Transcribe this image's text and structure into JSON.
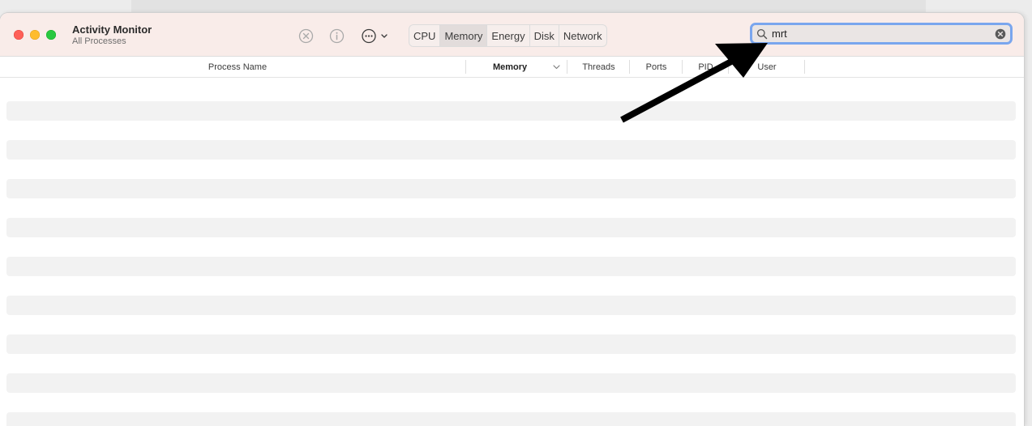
{
  "window": {
    "title": "Activity Monitor",
    "subtitle": "All Processes"
  },
  "toolbar": {
    "stop_icon": "x-circle-icon",
    "info_icon": "info-icon",
    "more_icon": "ellipsis-circle-icon",
    "tabs": [
      {
        "label": "CPU",
        "active": false
      },
      {
        "label": "Memory",
        "active": true
      },
      {
        "label": "Energy",
        "active": false
      },
      {
        "label": "Disk",
        "active": false
      },
      {
        "label": "Network",
        "active": false
      }
    ]
  },
  "search": {
    "value": "mrt",
    "icon": "magnifying-glass-icon",
    "clear_icon": "clear-circle-icon"
  },
  "table": {
    "columns": [
      {
        "label": "Process Name"
      },
      {
        "label": "Memory",
        "sorted": true
      },
      {
        "label": "Threads"
      },
      {
        "label": "Ports"
      },
      {
        "label": "PID"
      },
      {
        "label": "User"
      }
    ],
    "rows": []
  },
  "annotation": {
    "type": "arrow",
    "color": "#000000",
    "points_to": "search-field"
  }
}
